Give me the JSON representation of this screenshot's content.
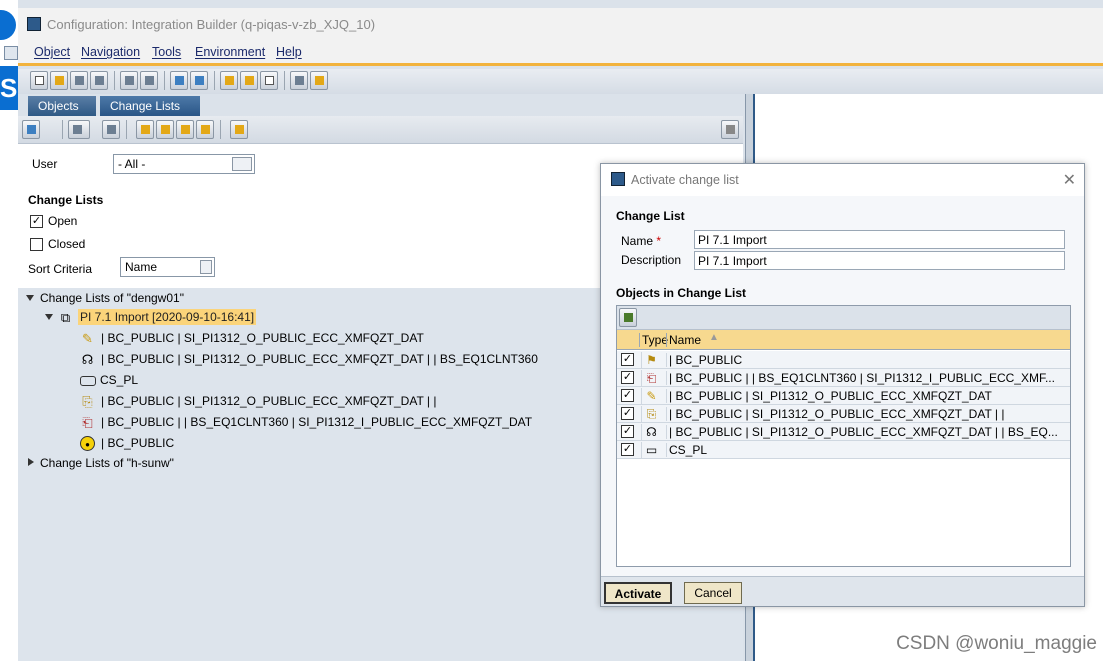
{
  "window": {
    "title": "Configuration: Integration Builder (q-piqas-v-zb_XJQ_10)"
  },
  "menu": [
    "Object",
    "Navigation",
    "Tools",
    "Environment",
    "Help"
  ],
  "left_edge": {
    "letter": "S"
  },
  "tabs": {
    "objects": "Objects",
    "change_lists": "Change Lists"
  },
  "filter": {
    "user_label": "User",
    "user_value": "- All -",
    "change_lists_heading": "Change Lists",
    "open_label": "Open",
    "open_checked": true,
    "closed_label": "Closed",
    "closed_checked": false,
    "sort_label": "Sort Criteria",
    "sort_value": "Name"
  },
  "tree": {
    "group1": "Change Lists of \"dengw01\"",
    "selected": "PI 7.1 Import [2020-09-10-16:41]",
    "items": [
      {
        "icon": "edit-pencil-icon",
        "text": "| BC_PUBLIC | SI_PI1312_O_PUBLIC_ECC_XMFQZT_DAT"
      },
      {
        "icon": "headset-icon",
        "text": "| BC_PUBLIC | SI_PI1312_O_PUBLIC_ECC_XMFQZT_DAT | | BS_EQ1CLNT360"
      },
      {
        "icon": "comm-channel-icon",
        "text": "CS_PL"
      },
      {
        "icon": "sender-agreement-icon",
        "text": "| BC_PUBLIC | SI_PI1312_O_PUBLIC_ECC_XMFQZT_DAT | |"
      },
      {
        "icon": "receiver-agreement-icon",
        "text": "| BC_PUBLIC | | BS_EQ1CLNT360 | SI_PI1312_I_PUBLIC_ECC_XMFQZT_DAT"
      },
      {
        "icon": "business-component-icon",
        "text": "| BC_PUBLIC"
      }
    ],
    "group2": "Change Lists of \"h-sunw\""
  },
  "dialog": {
    "title": "Activate change list",
    "section1": "Change List",
    "name_label": "Name",
    "name_value": "PI 7.1 Import",
    "desc_label": "Description",
    "desc_value": "PI 7.1 Import",
    "section2": "Objects in Change List",
    "col_type": "Type",
    "col_name": "Name",
    "rows": [
      {
        "checked": true,
        "icon": "business-component-icon",
        "name": "| BC_PUBLIC"
      },
      {
        "checked": true,
        "icon": "receiver-agreement-icon",
        "name": "| BC_PUBLIC | | BS_EQ1CLNT360 | SI_PI1312_I_PUBLIC_ECC_XMF..."
      },
      {
        "checked": true,
        "icon": "edit-pencil-icon",
        "name": "| BC_PUBLIC | SI_PI1312_O_PUBLIC_ECC_XMFQZT_DAT"
      },
      {
        "checked": true,
        "icon": "sender-agreement-icon",
        "name": "| BC_PUBLIC | SI_PI1312_O_PUBLIC_ECC_XMFQZT_DAT | |"
      },
      {
        "checked": true,
        "icon": "headset-icon",
        "name": "| BC_PUBLIC | SI_PI1312_O_PUBLIC_ECC_XMFQZT_DAT | | BS_EQ..."
      },
      {
        "checked": true,
        "icon": "comm-channel-icon",
        "name": "CS_PL"
      }
    ],
    "activate": "Activate",
    "cancel": "Cancel"
  },
  "watermark": "CSDN @woniu_maggie",
  "colors": {
    "accent": "#f2b33d",
    "selection": "#fbd47a",
    "tab_blue": "#2e5985",
    "grid_header": "#f7d98f"
  }
}
